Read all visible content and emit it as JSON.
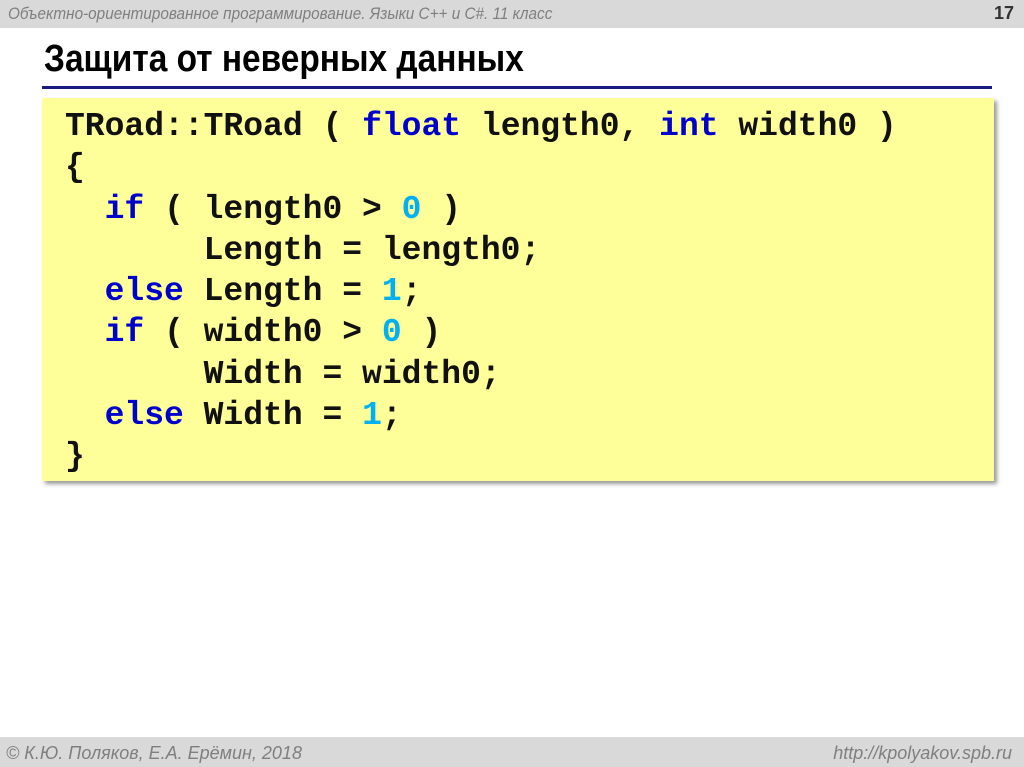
{
  "header": {
    "course": "Объектно-ориентированное программирование. Языки C++ и C#. 11 класс",
    "page_number": "17"
  },
  "title": "Защита от неверных данных",
  "code_lines": [
    [
      {
        "t": "TRoad::TRoad ( ",
        "c": ""
      },
      {
        "t": "float",
        "c": "kw"
      },
      {
        "t": " length0, ",
        "c": ""
      },
      {
        "t": "int",
        "c": "kw"
      },
      {
        "t": " width0 )",
        "c": ""
      }
    ],
    [
      {
        "t": "{",
        "c": ""
      }
    ],
    [
      {
        "t": "  ",
        "c": ""
      },
      {
        "t": "if",
        "c": "kw"
      },
      {
        "t": " ( length0 > ",
        "c": ""
      },
      {
        "t": "0",
        "c": "num"
      },
      {
        "t": " )",
        "c": ""
      }
    ],
    [
      {
        "t": "       Length = length0;",
        "c": ""
      }
    ],
    [
      {
        "t": "  ",
        "c": ""
      },
      {
        "t": "else",
        "c": "kw"
      },
      {
        "t": " Length = ",
        "c": ""
      },
      {
        "t": "1",
        "c": "num"
      },
      {
        "t": ";",
        "c": ""
      }
    ],
    [
      {
        "t": "  ",
        "c": ""
      },
      {
        "t": "if",
        "c": "kw"
      },
      {
        "t": " ( width0 > ",
        "c": ""
      },
      {
        "t": "0",
        "c": "num"
      },
      {
        "t": " )",
        "c": ""
      }
    ],
    [
      {
        "t": "       Width = width0;",
        "c": ""
      }
    ],
    [
      {
        "t": "  ",
        "c": ""
      },
      {
        "t": "else",
        "c": "kw"
      },
      {
        "t": " Width = ",
        "c": ""
      },
      {
        "t": "1",
        "c": "num"
      },
      {
        "t": ";",
        "c": ""
      }
    ],
    [
      {
        "t": "}",
        "c": ""
      }
    ]
  ],
  "footer": {
    "copyright": "© К.Ю. Поляков, Е.А. Ерёмин, 2018",
    "url": "http://kpolyakov.spb.ru"
  },
  "colors": {
    "keyword": "#0000cc",
    "number": "#00b0f0",
    "code_bg": "#ffff99",
    "rule": "#1a1a80"
  }
}
